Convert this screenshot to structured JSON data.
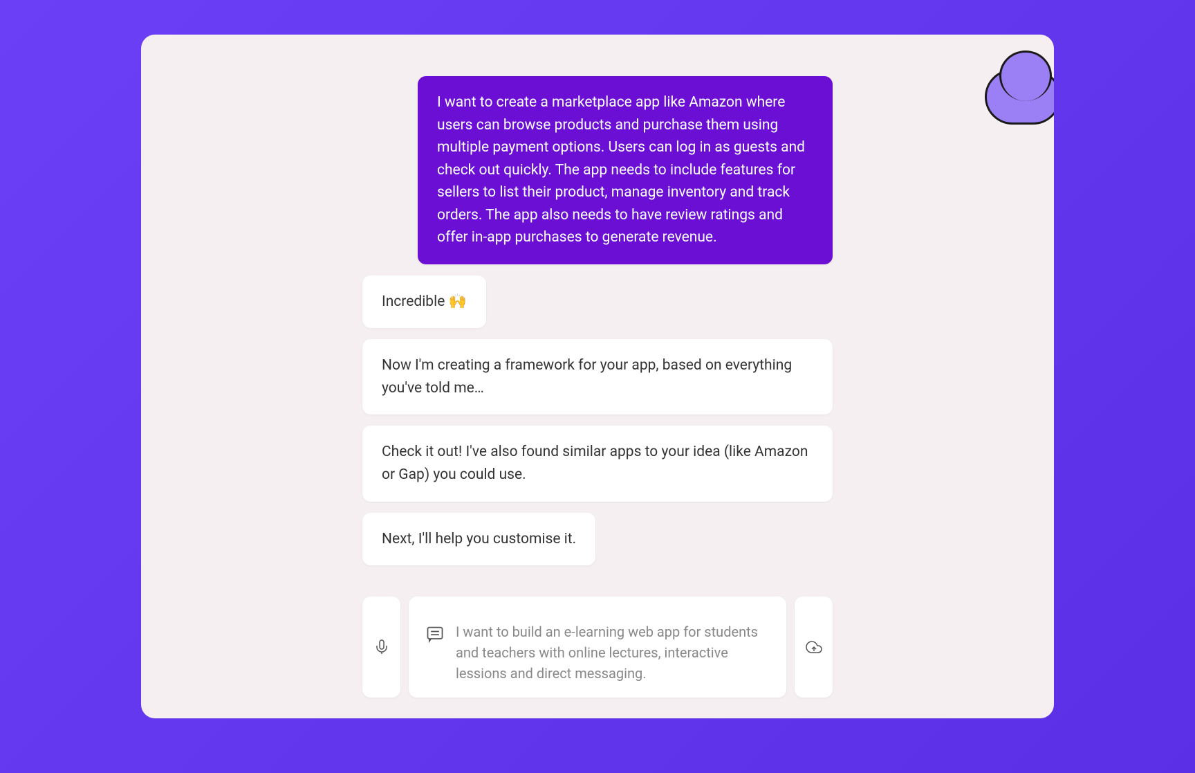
{
  "messages": {
    "user1": "I want to create a marketplace app like Amazon where users can browse products and purchase them using multiple payment options. Users can log in as guests and check out quickly. The app needs to include features for sellers to list their product, manage inventory and track orders. The app also needs to have review ratings and offer in-app purchases to generate revenue.",
    "bot1": "Incredible 🙌",
    "bot2": "Now I'm creating a framework for your app, based on everything you've told me…",
    "bot3": "Check it out! I've also found similar apps to your idea (like Amazon or Gap) you could use.",
    "bot4": "Next, I'll help you customise it."
  },
  "input": {
    "placeholder": "I want to build an e-learning web app for students and teachers with online lectures, interactive lessions and direct messaging."
  },
  "colors": {
    "background_gradient_start": "#6B3FF5",
    "background_gradient_end": "#5B2FE5",
    "container_bg": "#F5EFF1",
    "user_bubble": "#6B0FD5",
    "bot_bubble": "#FFFFFF"
  }
}
